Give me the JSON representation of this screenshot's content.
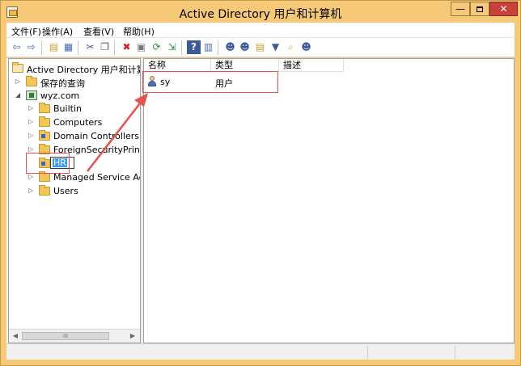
{
  "window": {
    "title": "Active Directory 用户和计算机",
    "minimize": "—",
    "close": "✕"
  },
  "menu": [
    {
      "label": "文件(F)"
    },
    {
      "label": "操作(A)"
    },
    {
      "label": "查看(V)"
    },
    {
      "label": "帮助(H)"
    }
  ],
  "toolbar": [
    {
      "icon": "back-arrow-icon",
      "glyph": "⇦",
      "color": "#4a6aa8"
    },
    {
      "icon": "forward-arrow-icon",
      "glyph": "⇨",
      "color": "#4a6aa8"
    },
    {
      "icon": "up-folder-icon",
      "glyph": "▤",
      "color": "#c9a032"
    },
    {
      "icon": "show-console-tree-icon",
      "glyph": "▦",
      "color": "#4a6aa8"
    },
    {
      "icon": "cut-icon",
      "glyph": "✂",
      "color": "#3a5a98"
    },
    {
      "icon": "copy-icon",
      "glyph": "❐",
      "color": "#555555"
    },
    {
      "icon": "delete-icon",
      "glyph": "✖",
      "color": "#d02020"
    },
    {
      "icon": "properties-icon",
      "glyph": "▣",
      "color": "#777777"
    },
    {
      "icon": "refresh-icon",
      "glyph": "⟳",
      "color": "#2a8a3a"
    },
    {
      "icon": "export-list-icon",
      "glyph": "⇲",
      "color": "#2a8a3a"
    },
    {
      "icon": "help-icon",
      "glyph": "?",
      "color": "#ffffff"
    },
    {
      "icon": "show-action-pane-icon",
      "glyph": "▥",
      "color": "#4a6aa8"
    },
    {
      "icon": "new-user-icon",
      "glyph": "☻",
      "color": "#3a5a98"
    },
    {
      "icon": "new-group-icon",
      "glyph": "☻",
      "color": "#3a5a98"
    },
    {
      "icon": "new-ou-icon",
      "glyph": "▤",
      "color": "#c9a032"
    },
    {
      "icon": "filter-icon",
      "glyph": "▼",
      "color": "#3a5a98"
    },
    {
      "icon": "find-icon",
      "glyph": "⌕",
      "color": "#c9a032"
    },
    {
      "icon": "add-to-group-icon",
      "glyph": "☻",
      "color": "#3a5a98"
    }
  ],
  "tree": {
    "root": "Active Directory 用户和计算机",
    "saved_queries": "保存的查询",
    "domain": "wyz.com",
    "children": [
      {
        "label": "Builtin",
        "type": "container"
      },
      {
        "label": "Computers",
        "type": "container"
      },
      {
        "label": "Domain Controllers",
        "type": "ou"
      },
      {
        "label": "ForeignSecurityPrincipals",
        "type": "container"
      },
      {
        "label": "HR",
        "type": "ou-editing"
      },
      {
        "label": "Managed Service Accounts",
        "type": "container"
      },
      {
        "label": "Users",
        "type": "container"
      }
    ],
    "scroll_thumb": "III"
  },
  "list": {
    "columns": [
      "名称",
      "类型",
      "描述"
    ],
    "rows": [
      {
        "name": "sy",
        "type": "用户",
        "description": ""
      }
    ]
  },
  "colors": {
    "frame": "#f5c97a",
    "close_button": "#c7403a",
    "annotation": "#e8504a",
    "selection": "#3399ff"
  }
}
